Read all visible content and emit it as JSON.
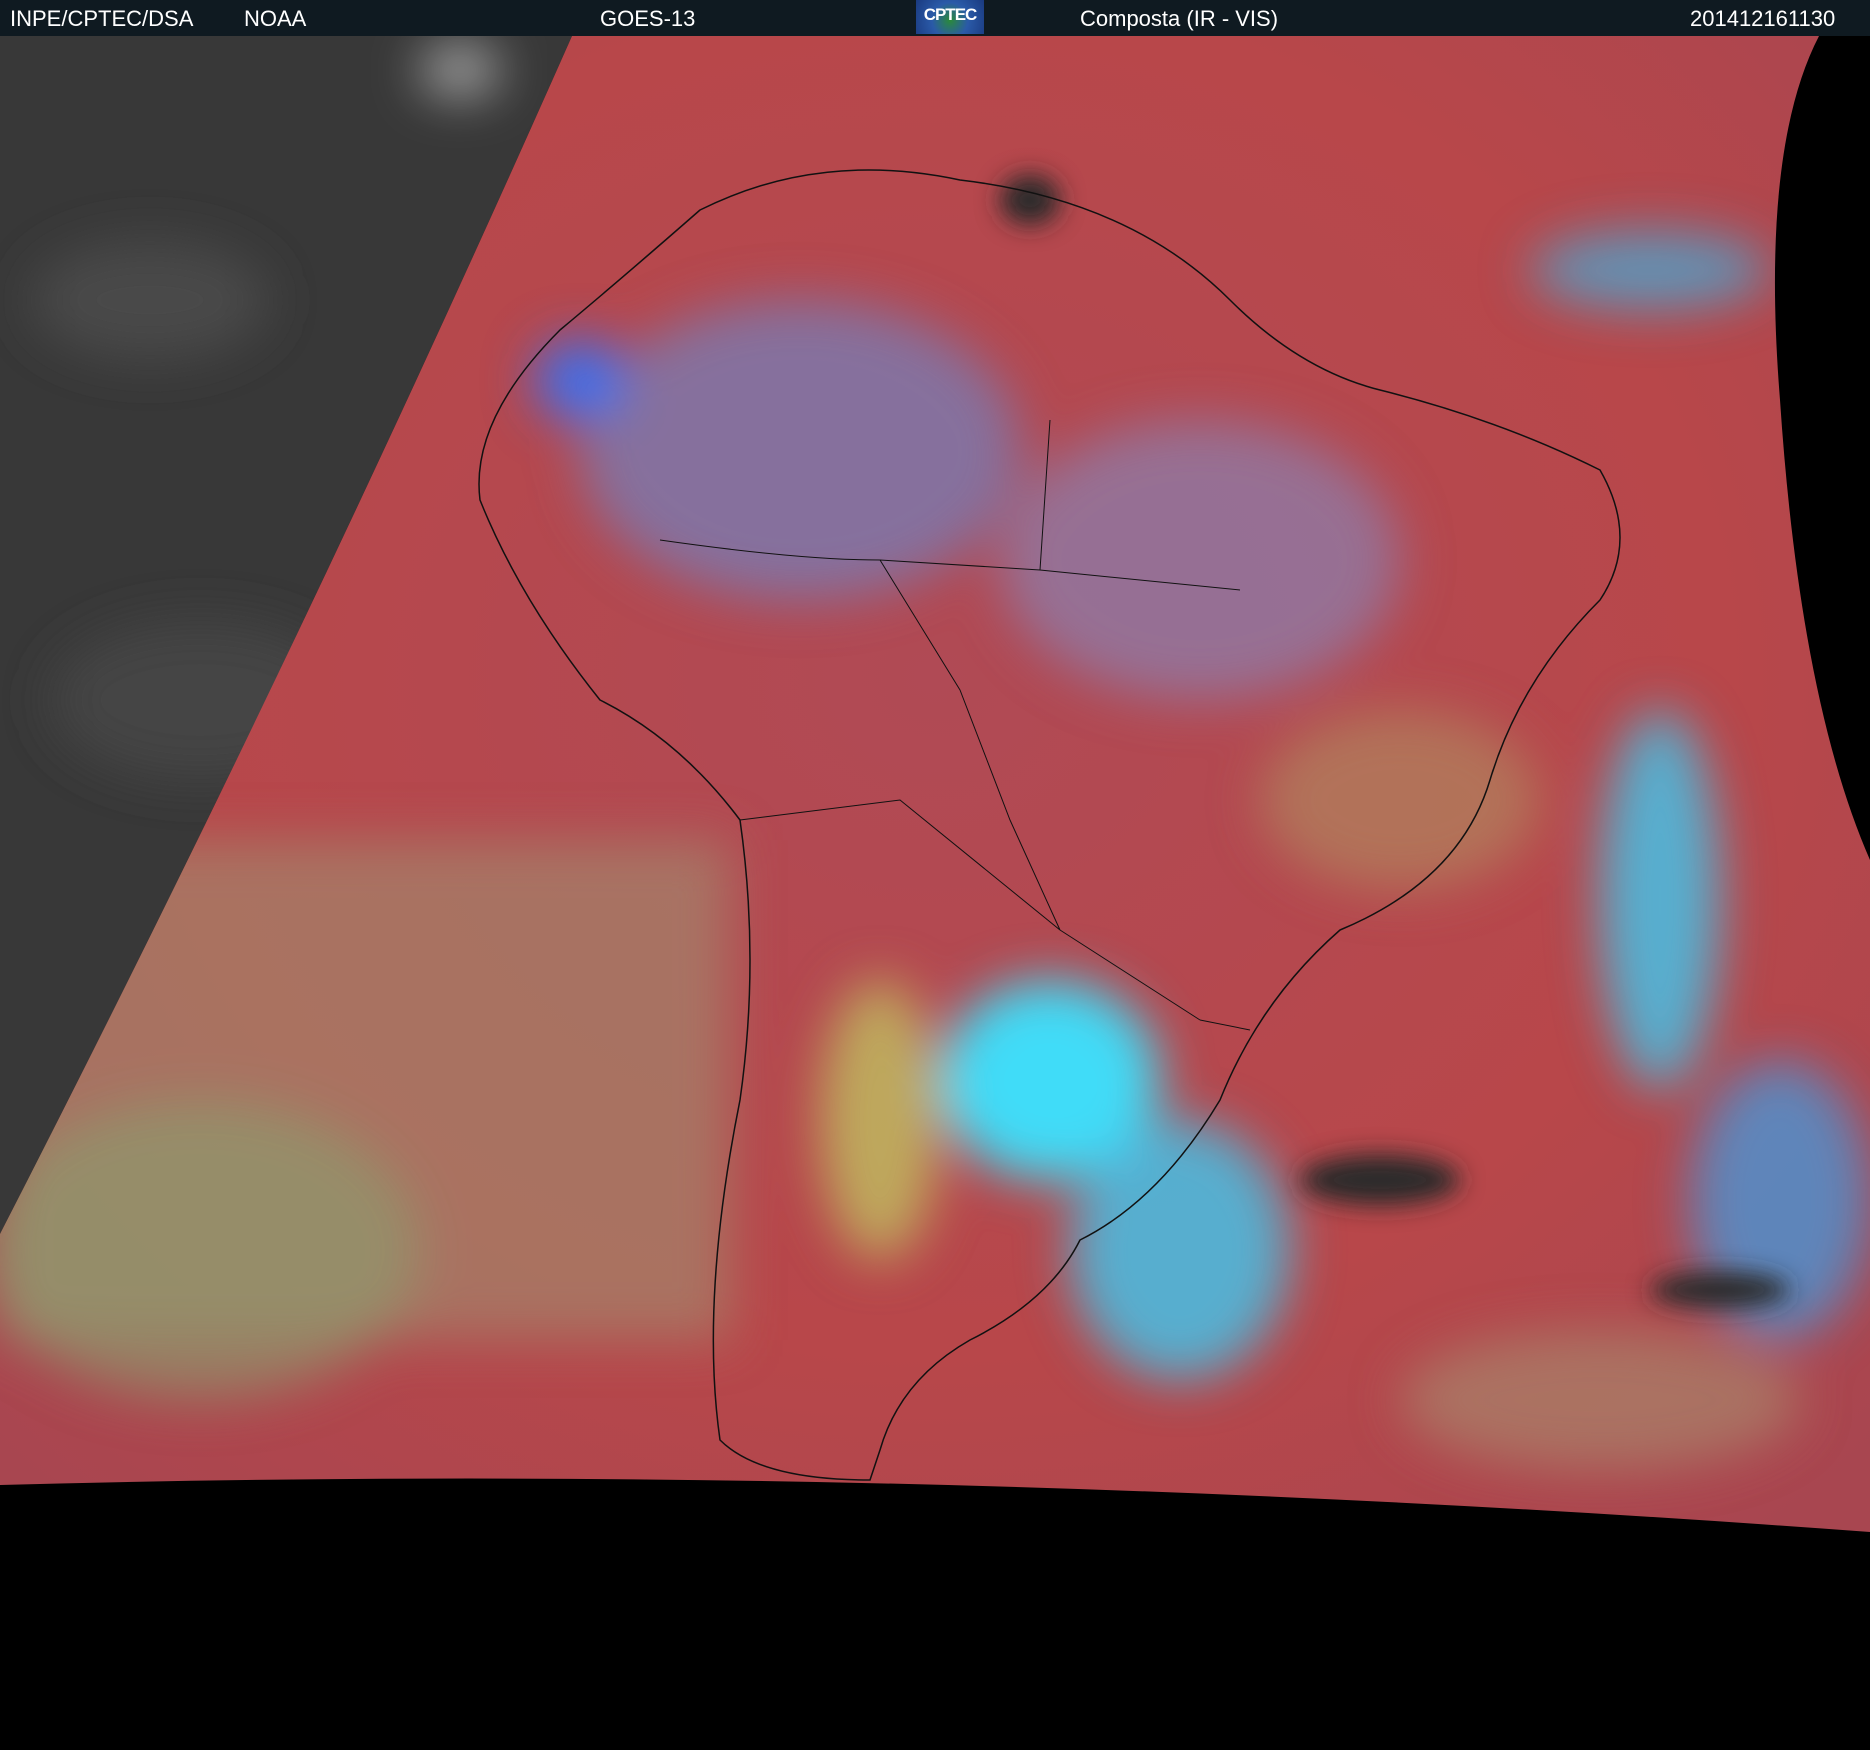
{
  "header": {
    "agency": "INPE/CPTEC/DSA",
    "source": "NOAA",
    "satellite": "GOES-13",
    "logo_text": "CPTEC",
    "product": "Composta (IR - VIS)",
    "timestamp": "201412161130"
  },
  "colors": {
    "header_bg": "#0f1a21",
    "ocean_red": "#b8474a",
    "cloud_cyan": "#3ad8f5",
    "cloud_blue": "#3a78e8",
    "ir_gray": "#3a3a3a"
  }
}
